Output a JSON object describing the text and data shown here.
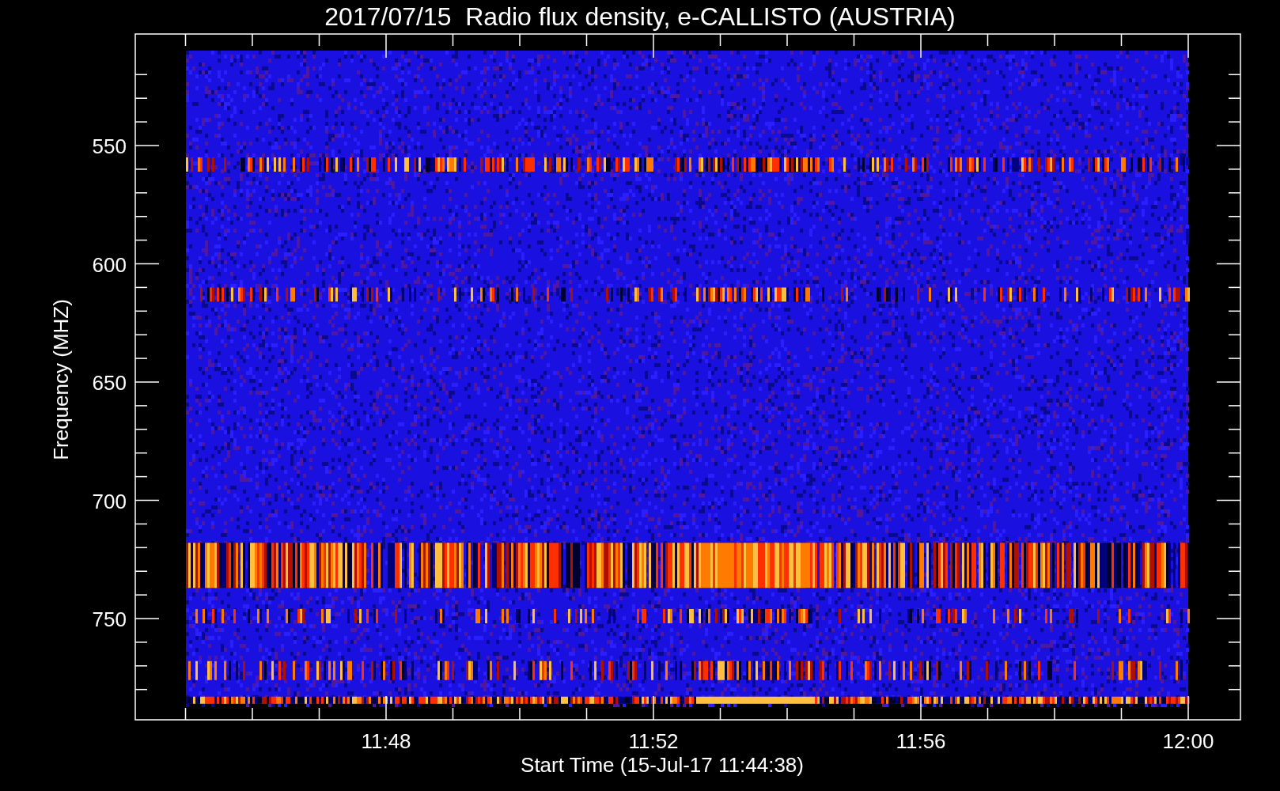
{
  "title": "2017/07/15  Radio flux density, e-CALLISTO (AUSTRIA)",
  "y_axis": {
    "label": "Frequency (MHZ)",
    "ticks": [
      "550",
      "600",
      "650",
      "700",
      "750"
    ]
  },
  "x_axis": {
    "label": "Start Time (15-Jul-17 11:44:38)",
    "ticks": [
      "11:48",
      "11:52",
      "11:56",
      "12:00"
    ]
  }
}
